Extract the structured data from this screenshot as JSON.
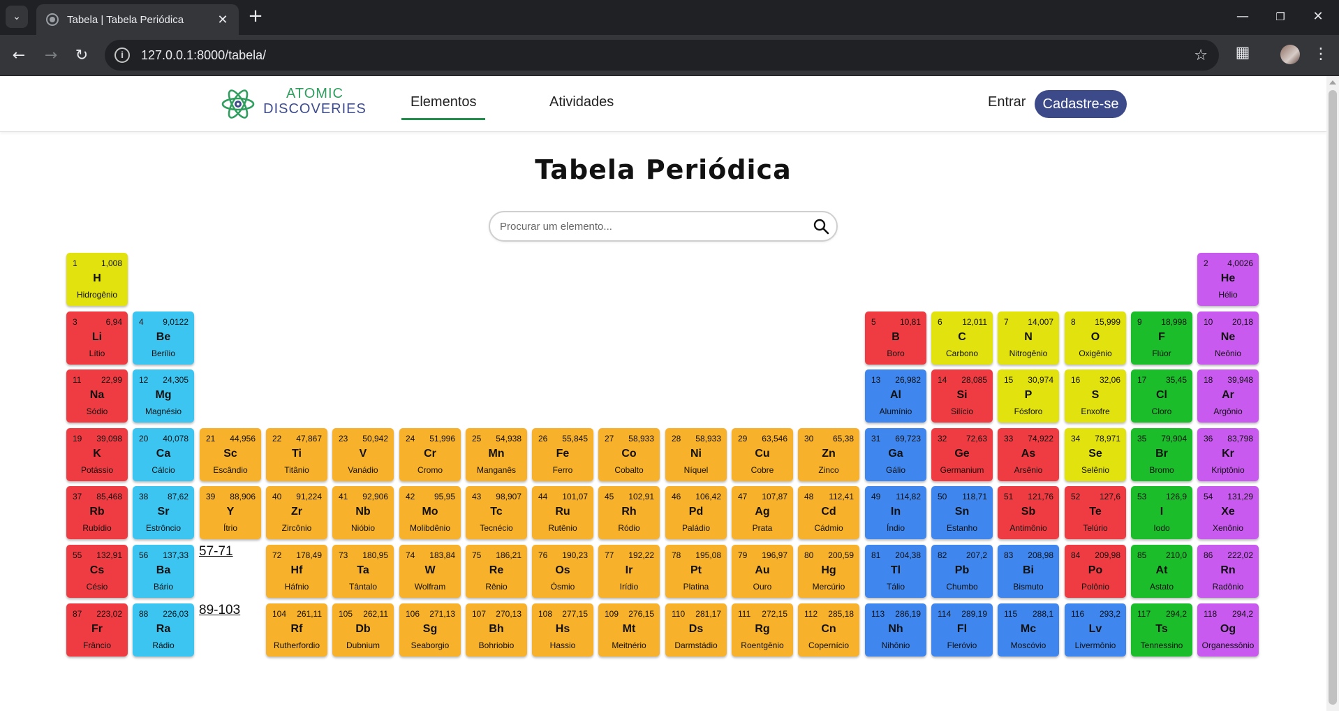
{
  "browser": {
    "tab_title": "Tabela | Tabela Periódica",
    "url": "127.0.0.1:8000/tabela/",
    "icons": [
      "tab-list-icon",
      "close-icon",
      "plus-icon",
      "minimize-icon",
      "restore-icon",
      "close-window-icon",
      "back-icon",
      "forward-icon",
      "reload-icon",
      "site-info-icon",
      "star-icon",
      "extensions-icon",
      "profile-avatar",
      "more-icon"
    ]
  },
  "header": {
    "brand_line1": "ATOMIC",
    "brand_line2": "DISCOVERIES",
    "nav": {
      "elements": "Elementos",
      "activities": "Atividades"
    },
    "login": "Entrar",
    "signup": "Cadastre-se"
  },
  "main": {
    "title": "Tabela Periódica",
    "search_placeholder": "Procurar um elemento...",
    "series_lanthanides": "57-71",
    "series_actinides": "89-103"
  },
  "colors": {
    "alkali": "#ef3c42",
    "alkaline": "#3dc5f2",
    "transition": "#f8b12a",
    "post": "#3f86ee",
    "nonmetal": "#e2e20f",
    "halogen": "#1bbd2b",
    "noble": "#c95af0",
    "brand_green": "#2f9e5e",
    "brand_blue": "#3d4a8a"
  },
  "elements": [
    {
      "n": "1",
      "m": "1,008",
      "s": "H",
      "name": "Hidrogênio",
      "g": 1,
      "p": 1,
      "c": "nonmetal"
    },
    {
      "n": "2",
      "m": "4,0026",
      "s": "He",
      "name": "Hélio",
      "g": 18,
      "p": 1,
      "c": "noble"
    },
    {
      "n": "3",
      "m": "6,94",
      "s": "Li",
      "name": "Lítio",
      "g": 1,
      "p": 2,
      "c": "alkali"
    },
    {
      "n": "4",
      "m": "9,0122",
      "s": "Be",
      "name": "Berílio",
      "g": 2,
      "p": 2,
      "c": "alkaline"
    },
    {
      "n": "5",
      "m": "10,81",
      "s": "B",
      "name": "Boro",
      "g": 13,
      "p": 2,
      "c": "alkali"
    },
    {
      "n": "6",
      "m": "12,011",
      "s": "C",
      "name": "Carbono",
      "g": 14,
      "p": 2,
      "c": "nonmetal"
    },
    {
      "n": "7",
      "m": "14,007",
      "s": "N",
      "name": "Nitrogênio",
      "g": 15,
      "p": 2,
      "c": "nonmetal"
    },
    {
      "n": "8",
      "m": "15,999",
      "s": "O",
      "name": "Oxigênio",
      "g": 16,
      "p": 2,
      "c": "nonmetal"
    },
    {
      "n": "9",
      "m": "18,998",
      "s": "F",
      "name": "Flúor",
      "g": 17,
      "p": 2,
      "c": "halogen"
    },
    {
      "n": "10",
      "m": "20,18",
      "s": "Ne",
      "name": "Neônio",
      "g": 18,
      "p": 2,
      "c": "noble"
    },
    {
      "n": "11",
      "m": "22,99",
      "s": "Na",
      "name": "Sódio",
      "g": 1,
      "p": 3,
      "c": "alkali"
    },
    {
      "n": "12",
      "m": "24,305",
      "s": "Mg",
      "name": "Magnésio",
      "g": 2,
      "p": 3,
      "c": "alkaline"
    },
    {
      "n": "13",
      "m": "26,982",
      "s": "Al",
      "name": "Alumínio",
      "g": 13,
      "p": 3,
      "c": "post"
    },
    {
      "n": "14",
      "m": "28,085",
      "s": "Si",
      "name": "Silício",
      "g": 14,
      "p": 3,
      "c": "alkali"
    },
    {
      "n": "15",
      "m": "30,974",
      "s": "P",
      "name": "Fósforo",
      "g": 15,
      "p": 3,
      "c": "nonmetal"
    },
    {
      "n": "16",
      "m": "32,06",
      "s": "S",
      "name": "Enxofre",
      "g": 16,
      "p": 3,
      "c": "nonmetal"
    },
    {
      "n": "17",
      "m": "35,45",
      "s": "Cl",
      "name": "Cloro",
      "g": 17,
      "p": 3,
      "c": "halogen"
    },
    {
      "n": "18",
      "m": "39,948",
      "s": "Ar",
      "name": "Argônio",
      "g": 18,
      "p": 3,
      "c": "noble"
    },
    {
      "n": "19",
      "m": "39,098",
      "s": "K",
      "name": "Potássio",
      "g": 1,
      "p": 4,
      "c": "alkali"
    },
    {
      "n": "20",
      "m": "40,078",
      "s": "Ca",
      "name": "Cálcio",
      "g": 2,
      "p": 4,
      "c": "alkaline"
    },
    {
      "n": "21",
      "m": "44,956",
      "s": "Sc",
      "name": "Escândio",
      "g": 3,
      "p": 4,
      "c": "transition"
    },
    {
      "n": "22",
      "m": "47,867",
      "s": "Ti",
      "name": "Titânio",
      "g": 4,
      "p": 4,
      "c": "transition"
    },
    {
      "n": "23",
      "m": "50,942",
      "s": "V",
      "name": "Vanádio",
      "g": 5,
      "p": 4,
      "c": "transition"
    },
    {
      "n": "24",
      "m": "51,996",
      "s": "Cr",
      "name": "Cromo",
      "g": 6,
      "p": 4,
      "c": "transition"
    },
    {
      "n": "25",
      "m": "54,938",
      "s": "Mn",
      "name": "Manganês",
      "g": 7,
      "p": 4,
      "c": "transition"
    },
    {
      "n": "26",
      "m": "55,845",
      "s": "Fe",
      "name": "Ferro",
      "g": 8,
      "p": 4,
      "c": "transition"
    },
    {
      "n": "27",
      "m": "58,933",
      "s": "Co",
      "name": "Cobalto",
      "g": 9,
      "p": 4,
      "c": "transition"
    },
    {
      "n": "28",
      "m": "58,933",
      "s": "Ni",
      "name": "Níquel",
      "g": 10,
      "p": 4,
      "c": "transition"
    },
    {
      "n": "29",
      "m": "63,546",
      "s": "Cu",
      "name": "Cobre",
      "g": 11,
      "p": 4,
      "c": "transition"
    },
    {
      "n": "30",
      "m": "65,38",
      "s": "Zn",
      "name": "Zinco",
      "g": 12,
      "p": 4,
      "c": "transition"
    },
    {
      "n": "31",
      "m": "69,723",
      "s": "Ga",
      "name": "Gálio",
      "g": 13,
      "p": 4,
      "c": "post"
    },
    {
      "n": "32",
      "m": "72,63",
      "s": "Ge",
      "name": "Germanium",
      "g": 14,
      "p": 4,
      "c": "alkali"
    },
    {
      "n": "33",
      "m": "74,922",
      "s": "As",
      "name": "Arsênio",
      "g": 15,
      "p": 4,
      "c": "alkali"
    },
    {
      "n": "34",
      "m": "78,971",
      "s": "Se",
      "name": "Selênio",
      "g": 16,
      "p": 4,
      "c": "nonmetal"
    },
    {
      "n": "35",
      "m": "79,904",
      "s": "Br",
      "name": "Bromo",
      "g": 17,
      "p": 4,
      "c": "halogen"
    },
    {
      "n": "36",
      "m": "83,798",
      "s": "Kr",
      "name": "Kriptônio",
      "g": 18,
      "p": 4,
      "c": "noble"
    },
    {
      "n": "37",
      "m": "85,468",
      "s": "Rb",
      "name": "Rubídio",
      "g": 1,
      "p": 5,
      "c": "alkali"
    },
    {
      "n": "38",
      "m": "87,62",
      "s": "Sr",
      "name": "Estrôncio",
      "g": 2,
      "p": 5,
      "c": "alkaline"
    },
    {
      "n": "39",
      "m": "88,906",
      "s": "Y",
      "name": "Ítrio",
      "g": 3,
      "p": 5,
      "c": "transition"
    },
    {
      "n": "40",
      "m": "91,224",
      "s": "Zr",
      "name": "Zircônio",
      "g": 4,
      "p": 5,
      "c": "transition"
    },
    {
      "n": "41",
      "m": "92,906",
      "s": "Nb",
      "name": "Nióbio",
      "g": 5,
      "p": 5,
      "c": "transition"
    },
    {
      "n": "42",
      "m": "95,95",
      "s": "Mo",
      "name": "Molibdênio",
      "g": 6,
      "p": 5,
      "c": "transition"
    },
    {
      "n": "43",
      "m": "98,907",
      "s": "Tc",
      "name": "Tecnécio",
      "g": 7,
      "p": 5,
      "c": "transition"
    },
    {
      "n": "44",
      "m": "101,07",
      "s": "Ru",
      "name": "Rutênio",
      "g": 8,
      "p": 5,
      "c": "transition"
    },
    {
      "n": "45",
      "m": "102,91",
      "s": "Rh",
      "name": "Ródio",
      "g": 9,
      "p": 5,
      "c": "transition"
    },
    {
      "n": "46",
      "m": "106,42",
      "s": "Pd",
      "name": "Paládio",
      "g": 10,
      "p": 5,
      "c": "transition"
    },
    {
      "n": "47",
      "m": "107,87",
      "s": "Ag",
      "name": "Prata",
      "g": 11,
      "p": 5,
      "c": "transition"
    },
    {
      "n": "48",
      "m": "112,41",
      "s": "Cd",
      "name": "Cádmio",
      "g": 12,
      "p": 5,
      "c": "transition"
    },
    {
      "n": "49",
      "m": "114,82",
      "s": "In",
      "name": "Índio",
      "g": 13,
      "p": 5,
      "c": "post"
    },
    {
      "n": "50",
      "m": "118,71",
      "s": "Sn",
      "name": "Estanho",
      "g": 14,
      "p": 5,
      "c": "post"
    },
    {
      "n": "51",
      "m": "121,76",
      "s": "Sb",
      "name": "Antimônio",
      "g": 15,
      "p": 5,
      "c": "alkali"
    },
    {
      "n": "52",
      "m": "127,6",
      "s": "Te",
      "name": "Telúrio",
      "g": 16,
      "p": 5,
      "c": "alkali"
    },
    {
      "n": "53",
      "m": "126,9",
      "s": "I",
      "name": "Iodo",
      "g": 17,
      "p": 5,
      "c": "halogen"
    },
    {
      "n": "54",
      "m": "131,29",
      "s": "Xe",
      "name": "Xenônio",
      "g": 18,
      "p": 5,
      "c": "noble"
    },
    {
      "n": "55",
      "m": "132,91",
      "s": "Cs",
      "name": "Césio",
      "g": 1,
      "p": 6,
      "c": "alkali"
    },
    {
      "n": "56",
      "m": "137,33",
      "s": "Ba",
      "name": "Bário",
      "g": 2,
      "p": 6,
      "c": "alkaline"
    },
    {
      "n": "72",
      "m": "178,49",
      "s": "Hf",
      "name": "Háfnio",
      "g": 4,
      "p": 6,
      "c": "transition"
    },
    {
      "n": "73",
      "m": "180,95",
      "s": "Ta",
      "name": "Tântalo",
      "g": 5,
      "p": 6,
      "c": "transition"
    },
    {
      "n": "74",
      "m": "183,84",
      "s": "W",
      "name": "Wolfram",
      "g": 6,
      "p": 6,
      "c": "transition"
    },
    {
      "n": "75",
      "m": "186,21",
      "s": "Re",
      "name": "Rênio",
      "g": 7,
      "p": 6,
      "c": "transition"
    },
    {
      "n": "76",
      "m": "190,23",
      "s": "Os",
      "name": "Ósmio",
      "g": 8,
      "p": 6,
      "c": "transition"
    },
    {
      "n": "77",
      "m": "192,22",
      "s": "Ir",
      "name": "Irídio",
      "g": 9,
      "p": 6,
      "c": "transition"
    },
    {
      "n": "78",
      "m": "195,08",
      "s": "Pt",
      "name": "Platina",
      "g": 10,
      "p": 6,
      "c": "transition"
    },
    {
      "n": "79",
      "m": "196,97",
      "s": "Au",
      "name": "Ouro",
      "g": 11,
      "p": 6,
      "c": "transition"
    },
    {
      "n": "80",
      "m": "200,59",
      "s": "Hg",
      "name": "Mercúrio",
      "g": 12,
      "p": 6,
      "c": "transition"
    },
    {
      "n": "81",
      "m": "204,38",
      "s": "Tl",
      "name": "Tálio",
      "g": 13,
      "p": 6,
      "c": "post"
    },
    {
      "n": "82",
      "m": "207,2",
      "s": "Pb",
      "name": "Chumbo",
      "g": 14,
      "p": 6,
      "c": "post"
    },
    {
      "n": "83",
      "m": "208,98",
      "s": "Bi",
      "name": "Bismuto",
      "g": 15,
      "p": 6,
      "c": "post"
    },
    {
      "n": "84",
      "m": "209,98",
      "s": "Po",
      "name": "Polônio",
      "g": 16,
      "p": 6,
      "c": "alkali"
    },
    {
      "n": "85",
      "m": "210,0",
      "s": "At",
      "name": "Astato",
      "g": 17,
      "p": 6,
      "c": "halogen"
    },
    {
      "n": "86",
      "m": "222,02",
      "s": "Rn",
      "name": "Radônio",
      "g": 18,
      "p": 6,
      "c": "noble"
    },
    {
      "n": "87",
      "m": "223,02",
      "s": "Fr",
      "name": "Frâncio",
      "g": 1,
      "p": 7,
      "c": "alkali"
    },
    {
      "n": "88",
      "m": "226,03",
      "s": "Ra",
      "name": "Rádio",
      "g": 2,
      "p": 7,
      "c": "alkaline"
    },
    {
      "n": "104",
      "m": "261,11",
      "s": "Rf",
      "name": "Rutherfordio",
      "g": 4,
      "p": 7,
      "c": "transition"
    },
    {
      "n": "105",
      "m": "262,11",
      "s": "Db",
      "name": "Dubnium",
      "g": 5,
      "p": 7,
      "c": "transition"
    },
    {
      "n": "106",
      "m": "271,13",
      "s": "Sg",
      "name": "Seaborgio",
      "g": 6,
      "p": 7,
      "c": "transition"
    },
    {
      "n": "107",
      "m": "270,13",
      "s": "Bh",
      "name": "Bohriobio",
      "g": 7,
      "p": 7,
      "c": "transition"
    },
    {
      "n": "108",
      "m": "277,15",
      "s": "Hs",
      "name": "Hassio",
      "g": 8,
      "p": 7,
      "c": "transition"
    },
    {
      "n": "109",
      "m": "276,15",
      "s": "Mt",
      "name": "Meitnério",
      "g": 9,
      "p": 7,
      "c": "transition"
    },
    {
      "n": "110",
      "m": "281,17",
      "s": "Ds",
      "name": "Darmstádio",
      "g": 10,
      "p": 7,
      "c": "transition"
    },
    {
      "n": "111",
      "m": "272,15",
      "s": "Rg",
      "name": "Roentgênio",
      "g": 11,
      "p": 7,
      "c": "transition"
    },
    {
      "n": "112",
      "m": "285,18",
      "s": "Cn",
      "name": "Copernício",
      "g": 12,
      "p": 7,
      "c": "transition"
    },
    {
      "n": "113",
      "m": "286,19",
      "s": "Nh",
      "name": "Nihônio",
      "g": 13,
      "p": 7,
      "c": "post"
    },
    {
      "n": "114",
      "m": "289,19",
      "s": "Fl",
      "name": "Fleróvio",
      "g": 14,
      "p": 7,
      "c": "post"
    },
    {
      "n": "115",
      "m": "288,1",
      "s": "Mc",
      "name": "Moscóvio",
      "g": 15,
      "p": 7,
      "c": "post"
    },
    {
      "n": "116",
      "m": "293,2",
      "s": "Lv",
      "name": "Livermônio",
      "g": 16,
      "p": 7,
      "c": "post"
    },
    {
      "n": "117",
      "m": "294,2",
      "s": "Ts",
      "name": "Tennessino",
      "g": 17,
      "p": 7,
      "c": "halogen"
    },
    {
      "n": "118",
      "m": "294,2",
      "s": "Og",
      "name": "Organessônio",
      "g": 18,
      "p": 7,
      "c": "noble"
    }
  ]
}
